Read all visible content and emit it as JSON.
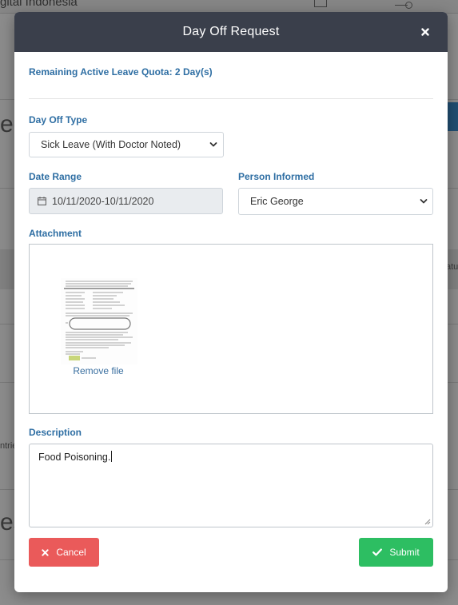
{
  "background": {
    "topbar_text": "gital Indonesia",
    "left_texts": [
      "ec",
      "es"
    ],
    "left_small": "ntrie",
    "right_small": "atu"
  },
  "modal": {
    "title": "Day Off Request",
    "close_icon": "close-icon",
    "quota_text": "Remaining Active Leave Quota: 2 Day(s)",
    "day_off_type": {
      "label": "Day Off Type",
      "selected": "Sick Leave (With Doctor Noted)"
    },
    "date_range": {
      "label": "Date Range",
      "value": "10/11/2020-10/11/2020"
    },
    "person_informed": {
      "label": "Person Informed",
      "selected": "Eric George"
    },
    "attachment": {
      "label": "Attachment",
      "remove_label": "Remove file"
    },
    "description": {
      "label": "Description",
      "value": "Food Poisoning."
    },
    "buttons": {
      "cancel": "Cancel",
      "submit": "Submit"
    }
  },
  "colors": {
    "header_bg": "#3a3f4b",
    "label_blue": "#2e6ea3",
    "cancel_red": "#ea5a5a",
    "submit_green": "#2dbe62"
  }
}
